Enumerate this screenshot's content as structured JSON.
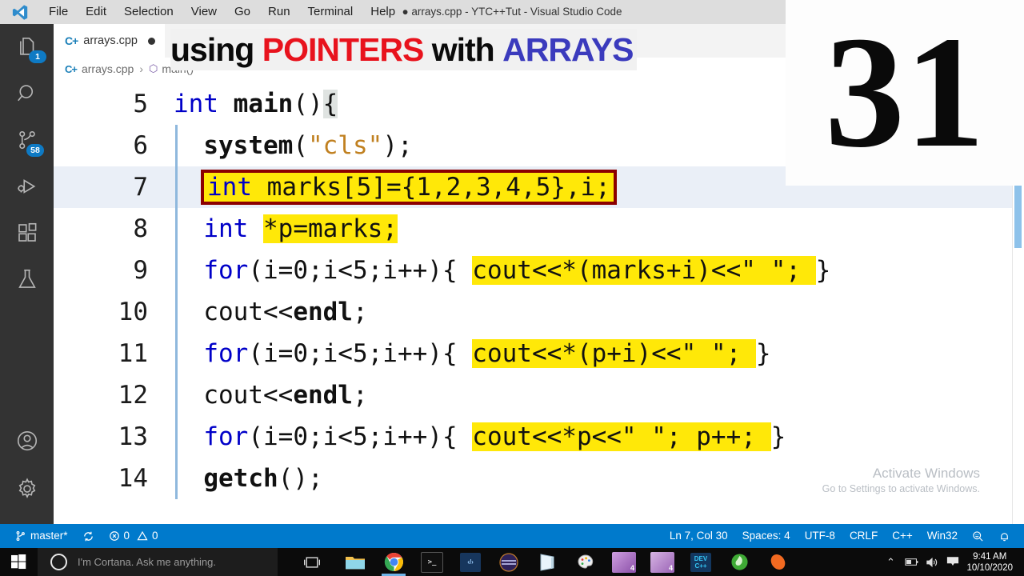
{
  "window": {
    "title": "● arrays.cpp - YTC++Tut - Visual Studio Code",
    "logo_icon": "vscode-logo-icon"
  },
  "menubar": {
    "items": [
      {
        "label": "File"
      },
      {
        "label": "Edit"
      },
      {
        "label": "Selection"
      },
      {
        "label": "View"
      },
      {
        "label": "Go"
      },
      {
        "label": "Run"
      },
      {
        "label": "Terminal"
      },
      {
        "label": "Help"
      }
    ]
  },
  "activitybar": {
    "items": [
      {
        "name": "explorer",
        "icon": "files-icon",
        "badge": "1"
      },
      {
        "name": "search",
        "icon": "search-icon",
        "badge": ""
      },
      {
        "name": "source-control",
        "icon": "source-control-icon",
        "badge": "58"
      },
      {
        "name": "run-and-debug",
        "icon": "run-debug-icon",
        "badge": ""
      },
      {
        "name": "extensions",
        "icon": "extensions-icon",
        "badge": ""
      },
      {
        "name": "testing",
        "icon": "flask-icon",
        "badge": ""
      },
      {
        "name": "accounts",
        "icon": "account-icon",
        "badge": ""
      },
      {
        "name": "manage",
        "icon": "gear-icon",
        "badge": ""
      }
    ]
  },
  "editor": {
    "tab": {
      "file_icon": "cpp-file-icon",
      "filename": "arrays.cpp",
      "dirty": true
    },
    "breadcrumb": {
      "file_icon": "cpp-file-icon",
      "file": "arrays.cpp",
      "separator": "›",
      "symbol_icon": "cube-symbol-icon",
      "symbol": "main()"
    },
    "lines": [
      {
        "number": "5",
        "text": "int main(){",
        "current": false
      },
      {
        "number": "6",
        "text": "  system(\"cls\");",
        "current": false
      },
      {
        "number": "7",
        "text": "  int marks[5]={1,2,3,4,5},i;",
        "current": true
      },
      {
        "number": "8",
        "text": "  int *p=marks;",
        "current": false
      },
      {
        "number": "9",
        "text": "  for(i=0;i<5;i++){ cout<<*(marks+i)<<\" \"; }",
        "current": false
      },
      {
        "number": "10",
        "text": "  cout<<endl;",
        "current": false
      },
      {
        "number": "11",
        "text": "  for(i=0;i<5;i++){ cout<<*(p+i)<<\" \"; }",
        "current": false
      },
      {
        "number": "12",
        "text": "  cout<<endl;",
        "current": false
      },
      {
        "number": "13",
        "text": "  for(i=0;i<5;i++){ cout<<*p<<\" \"; p++; }",
        "current": false
      },
      {
        "number": "14",
        "text": "  getch();",
        "current": false
      }
    ],
    "line5": {
      "kw": "int",
      "fn": " main",
      "rest": "()",
      "brace": "{"
    },
    "line6": {
      "fn": "  system",
      "p1": "(",
      "str": "\"cls\"",
      "p2": ");"
    },
    "line7": {
      "indent": "  ",
      "kw": "int",
      "rest": " marks[5]={1,2,3,4,5},i;"
    },
    "line8": {
      "indent": "  ",
      "kw": "int",
      "mid": " ",
      "hl": "*p=marks;"
    },
    "line9": {
      "indent": "  ",
      "kw": "for",
      "cond": "(i=0;i<5;i++){ ",
      "hl": "cout<<*(marks+i)<<\" \"; ",
      "tail": "}"
    },
    "line10": {
      "indent": "  ",
      "a": "cout<<",
      "b": "endl",
      "c": ";"
    },
    "line11": {
      "indent": "  ",
      "kw": "for",
      "cond": "(i=0;i<5;i++){ ",
      "hl": "cout<<*(p+i)<<\" \"; ",
      "tail": "}"
    },
    "line12": {
      "indent": "  ",
      "a": "cout<<",
      "b": "endl",
      "c": ";"
    },
    "line13": {
      "indent": "  ",
      "kw": "for",
      "cond": "(i=0;i<5;i++){ ",
      "hl": "cout<<*p<<\" \"; p++; ",
      "tail": "}"
    },
    "line14": {
      "indent": "  ",
      "fn": "getch",
      "rest": "();"
    }
  },
  "watermark": {
    "line1": "Activate Windows",
    "line2": "Go to Settings to activate Windows."
  },
  "statusbar": {
    "branch_icon": "source-control-branch-icon",
    "branch": "master*",
    "sync_icon": "sync-icon",
    "error_icon": "error-icon",
    "errors": "0",
    "warning_icon": "warning-icon",
    "warnings": "0",
    "position": "Ln 7, Col 30",
    "indentation": "Spaces: 4",
    "encoding": "UTF-8",
    "eol": "CRLF",
    "language": "C++",
    "platform": "Win32",
    "feedback_icon": "feedback-smiley-icon",
    "bell_icon": "bell-icon"
  },
  "taskbar": {
    "start_icon": "windows-start-icon",
    "cortana_icon": "cortana-circle-icon",
    "cortana_placeholder": "I'm Cortana. Ask me anything.",
    "taskview_icon": "task-view-icon",
    "apps": [
      {
        "name": "file-explorer-icon",
        "label": "",
        "color": "#f0c14b",
        "active": false
      },
      {
        "name": "google-chrome-icon",
        "label": "",
        "color": "#4285f4",
        "active": true
      },
      {
        "name": "command-prompt-icon",
        "label": "",
        "color": "#1a1a1a",
        "active": false
      },
      {
        "name": "code-editor-icon",
        "label": "",
        "color": "#17365d",
        "active": false
      },
      {
        "name": "purple-disc-icon",
        "label": "",
        "color": "#3b2a6b",
        "active": false
      },
      {
        "name": "onenote-icon",
        "label": "",
        "color": "#7c3fa0",
        "active": false
      },
      {
        "name": "paint-icon",
        "label": "",
        "color": "#e8e8e8",
        "active": false
      },
      {
        "name": "media-app-4-icon",
        "label": "4",
        "color": "#a05bb5",
        "active": false
      },
      {
        "name": "media-app-4b-icon",
        "label": "4",
        "color": "#a05bb5",
        "active": false
      },
      {
        "name": "dev-cpp-icon",
        "label": "DEV",
        "color": "#19406e",
        "active": false
      },
      {
        "name": "green-leaf-icon",
        "label": "",
        "color": "#3faa35",
        "active": false
      },
      {
        "name": "orange-oval-icon",
        "label": "",
        "color": "#f26a21",
        "active": false
      }
    ],
    "tray": {
      "chevron_icon": "show-hidden-icons-chevron",
      "battery_icon": "battery-icon",
      "volume_icon": "volume-icon",
      "action_center_icon": "action-center-icon",
      "time": "9:41 AM",
      "date": "10/10/2020"
    }
  },
  "overlay": {
    "title_parts": [
      {
        "text": "using ",
        "color": "#0a0a0a"
      },
      {
        "text": "POINTERS ",
        "color": "#e8131d"
      },
      {
        "text": "with ",
        "color": "#0a0a0a"
      },
      {
        "text": "ARRAYS",
        "color": "#3b3bbd"
      }
    ],
    "title_word1": "using",
    "title_word2": "POINTERS",
    "title_word3": "with",
    "title_word4": "ARRAYS",
    "episode_number": "31"
  }
}
